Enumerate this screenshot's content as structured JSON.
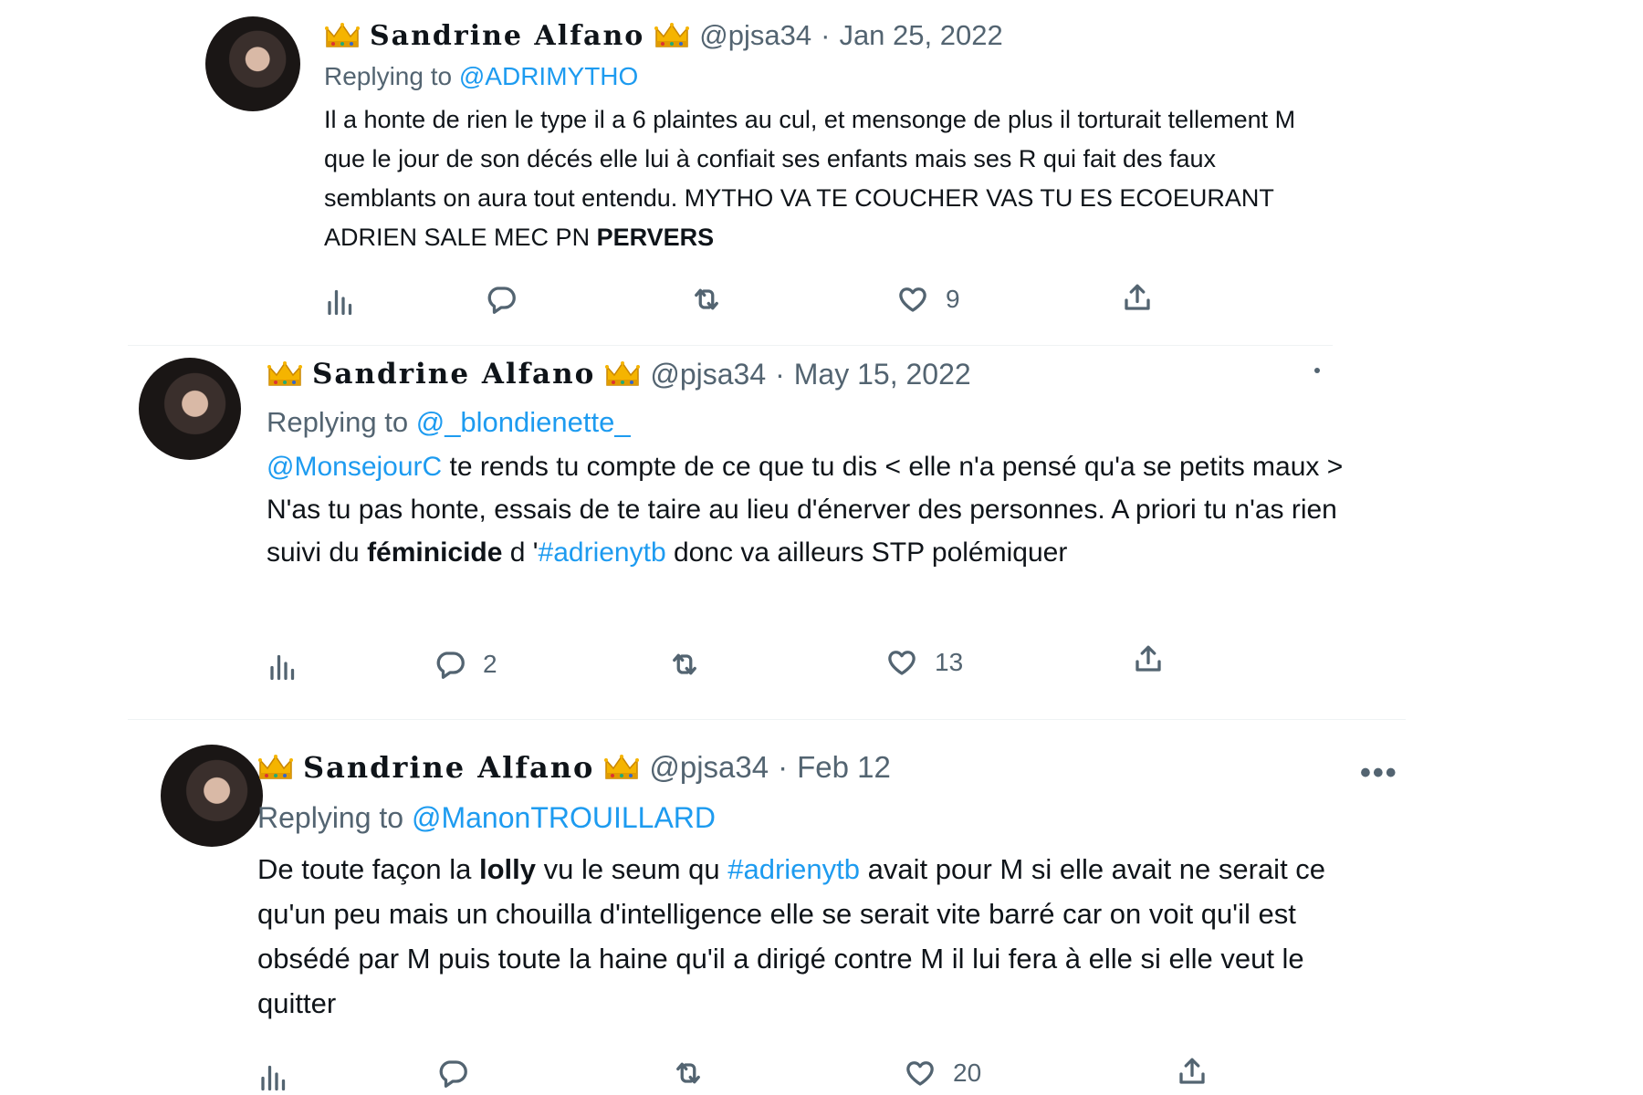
{
  "tweets": [
    {
      "display_name": "Sandrine Alfano",
      "handle": "@pjsa34",
      "date": "Jan 25, 2022",
      "replying_prefix": "Replying to",
      "replying_to": "@ADRIMYTHO",
      "text_main": "Il a honte de rien le type il a 6 plaintes au cul, et mensonge de plus il torturait tellement M que le jour de son décés elle lui à confiait ses enfants mais ses R qui fait des faux semblants on aura tout entendu. MYTHO VA TE COUCHER VAS TU ES ECOEURANT ADRIEN SALE MEC PN",
      "text_bold": "PERVERS",
      "actions": {
        "views": "",
        "replies": "",
        "retweets": "",
        "likes": "9"
      }
    },
    {
      "display_name": "Sandrine Alfano",
      "handle": "@pjsa34",
      "date": "May 15, 2022",
      "replying_prefix": "Replying to",
      "replying_to": "@_blondienette_",
      "mention": "@MonsejourC",
      "text_1": " te rends tu compte de ce que tu dis < elle n'a pensé qu'a se petits maux > N'as tu pas honte, essais de te taire au lieu d'énerver des personnes. A priori tu n'as rien suivi du ",
      "text_bold": "féminicide",
      "text_2": " d '",
      "hashtag": "#adrienytb",
      "text_3": " donc va ailleurs STP polémiquer",
      "actions": {
        "views": "",
        "replies": "2",
        "retweets": "",
        "likes": "13"
      }
    },
    {
      "display_name": "Sandrine Alfano",
      "handle": "@pjsa34",
      "date": "Feb 12",
      "replying_prefix": "Replying to",
      "replying_to": "@ManonTROUILLARD",
      "text_1": "De toute façon la ",
      "text_bold": "lolly",
      "text_2": " vu le seum qu ",
      "hashtag": "#adrienytb",
      "text_3": " avait pour M si elle avait ne serait ce qu'un peu mais un chouilla d'intelligence elle se serait vite barré car on voit qu'il est obsédé par M puis toute la haine qu'il a dirigé contre M il lui fera à elle si elle veut le quitter",
      "actions": {
        "views": "",
        "replies": "",
        "retweets": "",
        "likes": "20"
      }
    }
  ],
  "separator": "·",
  "more_label": "•••",
  "colors": {
    "accent": "#1d9bf0",
    "muted": "#536471",
    "text": "#0f1419"
  },
  "icons": [
    "crown-icon",
    "views-icon",
    "reply-icon",
    "retweet-icon",
    "like-icon",
    "share-icon",
    "more-icon"
  ]
}
